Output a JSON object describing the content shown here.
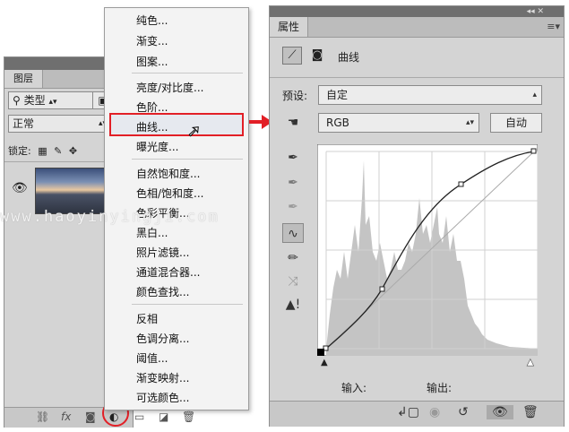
{
  "layers_panel": {
    "tab": "图层",
    "filter": {
      "icon": "search-icon",
      "label": "类型"
    },
    "blend_mode": "正常",
    "lock_label": "锁定:",
    "bottom_icons": [
      "link-icon",
      "fx-icon",
      "mask-icon",
      "adjustment-icon",
      "folder-icon",
      "new-layer-icon",
      "trash-icon"
    ],
    "fx_label": "fx"
  },
  "adjustment_menu": {
    "groups": [
      [
        "纯色...",
        "渐变...",
        "图案..."
      ],
      [
        "亮度/对比度...",
        "色阶...",
        "曲线...",
        "曝光度..."
      ],
      [
        "自然饱和度...",
        "色相/饱和度...",
        "色彩平衡...",
        "黑白...",
        "照片滤镜...",
        "通道混合器...",
        "颜色查找..."
      ],
      [
        "反相",
        "色调分离...",
        "阈值...",
        "渐变映射...",
        "可选颜色..."
      ]
    ],
    "highlighted": "曲线..."
  },
  "properties_panel": {
    "tab": "属性",
    "title": "曲线",
    "preset_label": "预设:",
    "preset_value": "自定",
    "channel_value": "RGB",
    "auto_button": "自动",
    "input_label": "输入:",
    "output_label": "输出:",
    "tool_icons": [
      "hand-target-icon",
      "black-eyedropper-icon",
      "gray-eyedropper-icon",
      "white-eyedropper-icon",
      "curve-point-icon",
      "pencil-icon",
      "smooth-icon",
      "clipping-warning-icon"
    ],
    "bottom_icons": [
      "clip-to-layer-icon",
      "view-previous-icon",
      "reset-icon",
      "visibility-icon",
      "trash-icon"
    ]
  },
  "watermark": "www.haoyinyingji.com",
  "colors": {
    "accent_red": "#e21f26",
    "panel": "#d4d4d4",
    "menu": "#f3f3f3"
  }
}
